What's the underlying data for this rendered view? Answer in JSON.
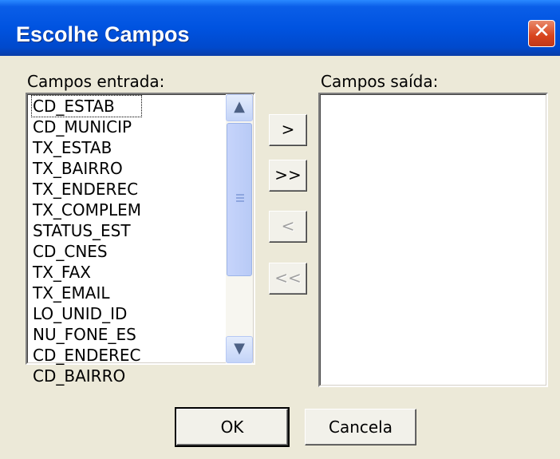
{
  "window": {
    "title": "Escolhe Campos",
    "close_glyph": "✕"
  },
  "left": {
    "label": "Campos entrada:",
    "items": [
      "CD_ESTAB",
      "CD_MUNICIP",
      "TX_ESTAB",
      "TX_BAIRRO",
      "TX_ENDEREC",
      "TX_COMPLEM",
      "STATUS_EST",
      "CD_CNES",
      "TX_FAX",
      "TX_EMAIL",
      "LO_UNID_ID",
      "NU_FONE_ES",
      "CD_ENDEREC",
      "CD_BAIRRO"
    ],
    "selected_index": 0,
    "scroll_up_glyph": "▲",
    "scroll_down_glyph": "▼"
  },
  "right": {
    "label": "Campos saída:",
    "items": []
  },
  "move_buttons": {
    "add_one": ">",
    "add_all": ">>",
    "remove_one": "<",
    "remove_all": "<<"
  },
  "footer": {
    "ok": "OK",
    "cancel": "Cancela"
  },
  "icons": {
    "close": "close-icon",
    "up": "arrow-up-icon",
    "down": "arrow-down-icon"
  }
}
